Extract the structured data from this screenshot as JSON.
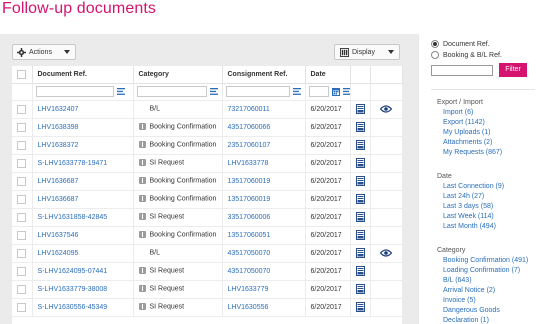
{
  "page": {
    "title": "Follow-up documents"
  },
  "toolbar": {
    "actions_label": "Actions",
    "display_label": "Display"
  },
  "table": {
    "headers": [
      "Document Ref.",
      "Category",
      "Consignment Ref.",
      "Date"
    ],
    "rows": [
      {
        "doc": "LHV1632407",
        "category": "B/L",
        "consignment": "73217060011",
        "date": "6/20/2017",
        "icon": "none",
        "pdf": true,
        "eye": true
      },
      {
        "doc": "LHV1638398",
        "category": "Booking Confirmation",
        "consignment": "43517060066",
        "date": "6/20/2017",
        "icon": "info",
        "pdf": true,
        "eye": false
      },
      {
        "doc": "LHV1638372",
        "category": "Booking Confirmation",
        "consignment": "23517060107",
        "date": "6/20/2017",
        "icon": "info",
        "pdf": true,
        "eye": false
      },
      {
        "doc": "S-LHV1633778-19471",
        "category": "SI Request",
        "consignment": "LHV1633778",
        "date": "6/20/2017",
        "icon": "si",
        "pdf": true,
        "eye": false
      },
      {
        "doc": "LHV1636687",
        "category": "Booking Confirmation",
        "consignment": "13517060019",
        "date": "6/20/2017",
        "icon": "info",
        "pdf": true,
        "eye": false
      },
      {
        "doc": "LHV1636687",
        "category": "Booking Confirmation",
        "consignment": "13517060019",
        "date": "6/20/2017",
        "icon": "info",
        "pdf": true,
        "eye": false
      },
      {
        "doc": "S-LHV1631858-42845",
        "category": "SI Request",
        "consignment": "33517060006",
        "date": "6/20/2017",
        "icon": "si",
        "pdf": true,
        "eye": false
      },
      {
        "doc": "LHV1637546",
        "category": "Booking Confirmation",
        "consignment": "13517060051",
        "date": "6/20/2017",
        "icon": "info",
        "pdf": true,
        "eye": false
      },
      {
        "doc": "LHV1624095",
        "category": "B/L",
        "consignment": "43517050070",
        "date": "6/20/2017",
        "icon": "none",
        "pdf": true,
        "eye": true
      },
      {
        "doc": "S-LHV1624095-07441",
        "category": "SI Request",
        "consignment": "43517050070",
        "date": "6/20/2017",
        "icon": "si",
        "pdf": true,
        "eye": false
      },
      {
        "doc": "S-LHV1633779-38008",
        "category": "SI Request",
        "consignment": "LHV1633779",
        "date": "6/20/2017",
        "icon": "si",
        "pdf": true,
        "eye": false
      },
      {
        "doc": "S-LHV1630556-45349",
        "category": "SI Request",
        "consignment": "LHV1630556",
        "date": "6/20/2017",
        "icon": "si",
        "pdf": true,
        "eye": false
      }
    ]
  },
  "sidebar": {
    "radio_options": [
      "Document Ref.",
      "Booking & B/L Ref."
    ],
    "filter_button": "Filter",
    "sections": [
      {
        "title": "Export / Import",
        "items": [
          "Import (6)",
          "Export (1142)",
          "My Uploads (1)",
          "Attachments (2)",
          "My Requests (867)"
        ]
      },
      {
        "title": "Date",
        "items": [
          "Last Connection (9)",
          "Last 24h (27)",
          "Last 3 days (58)",
          "Last Week (114)",
          "Last Month (494)"
        ]
      },
      {
        "title": "Category",
        "items": [
          "Booking Confirmation (491)",
          "Loading Confirmation (7)",
          "B/L (643)",
          "Arrival Notice (2)",
          "Invoice (5)",
          "Dangerous Goods",
          "Declaration (1)"
        ]
      }
    ]
  },
  "colors": {
    "brand": "#d4146e",
    "link": "#2a6ebb",
    "panel_bg": "#ebebeb"
  }
}
